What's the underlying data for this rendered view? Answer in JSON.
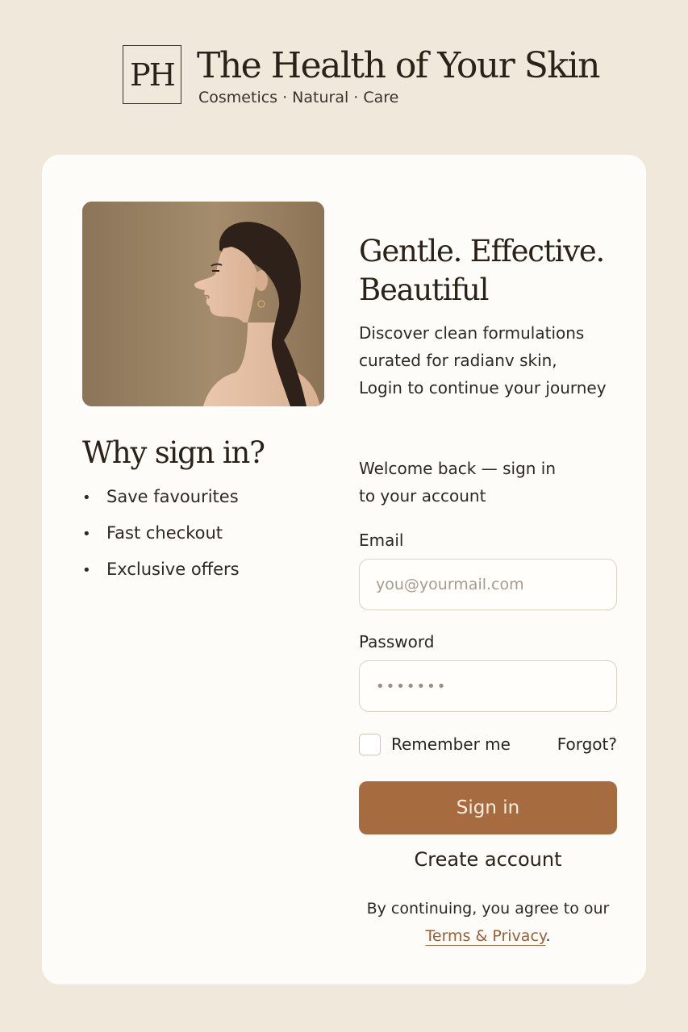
{
  "brand": {
    "monogram": "PH",
    "title": "The Health of Your Skin",
    "subtitle": "Cosmetics · Natural · Care"
  },
  "hero": {
    "tagline_line1": "Gentle. Effective.",
    "tagline_line2": "Beautiful",
    "intro_line1": "Discover clean formulations",
    "intro_line2": "curated for radianv skin,",
    "intro_line3": "Login to continue your journey"
  },
  "benefits": {
    "title": "Why sign in?",
    "items": [
      "Save favourites",
      "Fast checkout",
      "Exclusive offers"
    ]
  },
  "form": {
    "welcome_line1": "Welcome back — sign in",
    "welcome_line2": "to your account",
    "email_label": "Email",
    "email_placeholder": "you@yourmail.com",
    "password_label": "Password",
    "password_mask": "•••••••",
    "remember_label": "Remember me",
    "forgot_label": "Forgot?",
    "signin_label": "Sign in",
    "create_label": "Create account",
    "legal_text": "By continuing, you agree to our",
    "legal_link": "Terms & Privacy",
    "legal_end": "."
  },
  "colors": {
    "background": "#f1e8dc",
    "card": "#fdfcf8",
    "accent": "#a66b3f",
    "link": "#9a5e33"
  }
}
